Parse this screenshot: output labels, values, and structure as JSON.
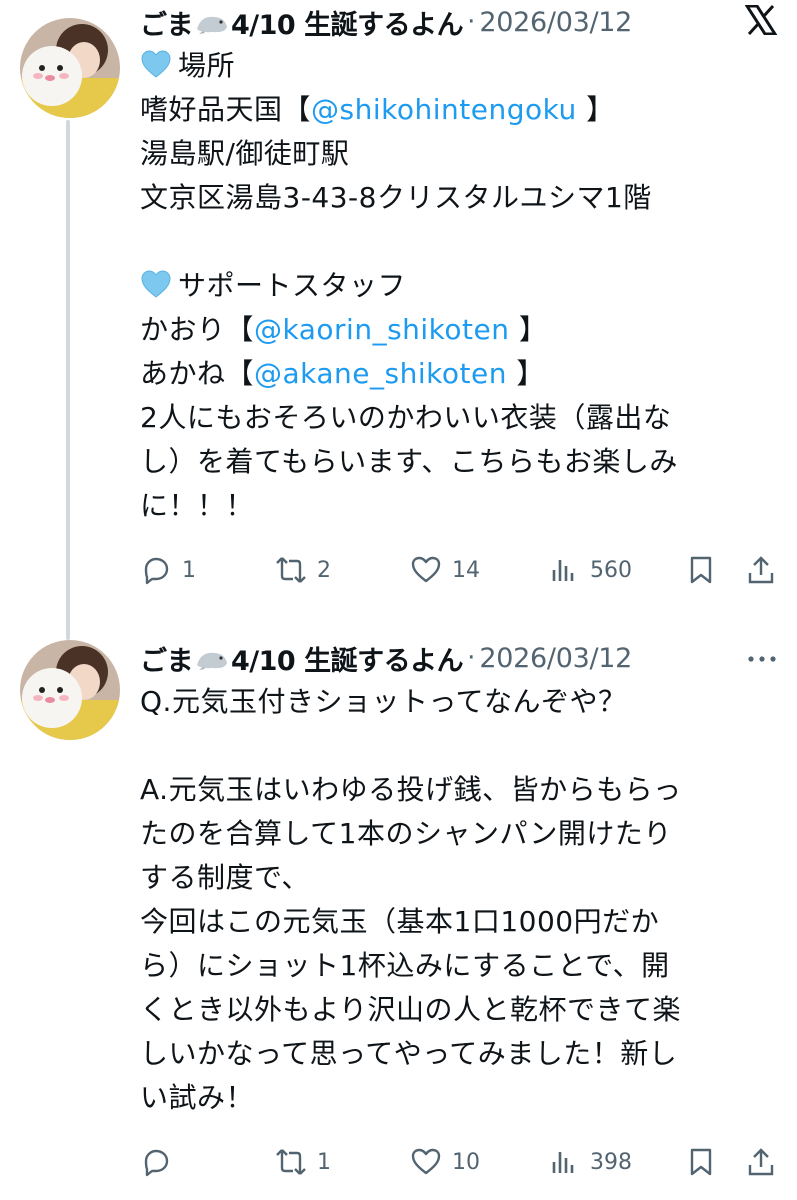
{
  "tweets": [
    {
      "author_name": "ごま",
      "author_suffix": "4/10 生誕するよん",
      "separator": "·",
      "date": "2026/03/12",
      "lines": [
        {
          "emoji": "light-blue-heart",
          "parts": [
            {
              "text": "場所"
            }
          ]
        },
        {
          "parts": [
            {
              "text": "嗜好品天国【"
            },
            {
              "text": "@shikohintengoku",
              "mention": true
            },
            {
              "text": " 】"
            }
          ]
        },
        {
          "parts": [
            {
              "text": "湯島駅/御徒町駅"
            }
          ]
        },
        {
          "parts": [
            {
              "text": "文京区湯島3-43-8クリスタルユシマ1階"
            }
          ]
        },
        {
          "parts": [
            {
              "text": ""
            }
          ]
        },
        {
          "emoji": "light-blue-heart",
          "parts": [
            {
              "text": "サポートスタッフ"
            }
          ]
        },
        {
          "parts": [
            {
              "text": "かおり【"
            },
            {
              "text": "@kaorin_shikoten",
              "mention": true
            },
            {
              "text": " 】"
            }
          ]
        },
        {
          "parts": [
            {
              "text": "あかね【"
            },
            {
              "text": "@akane_shikoten",
              "mention": true
            },
            {
              "text": " 】"
            }
          ]
        },
        {
          "parts": [
            {
              "text": "2人にもおそろいのかわいい衣装（露出な"
            }
          ]
        },
        {
          "parts": [
            {
              "text": "し）を着てもらいます、こちらもお楽しみ"
            }
          ]
        },
        {
          "parts": [
            {
              "text": "に！！！"
            }
          ]
        }
      ],
      "actions": {
        "replies": "1",
        "reposts": "2",
        "likes": "14",
        "views": "560"
      },
      "header_icon": "x-logo-icon"
    },
    {
      "author_name": "ごま",
      "author_suffix": "4/10 生誕するよん",
      "separator": "·",
      "date": "2026/03/12",
      "lines": [
        {
          "parts": [
            {
              "text": "Q.元気玉付きショットってなんぞや？"
            }
          ]
        },
        {
          "parts": [
            {
              "text": ""
            }
          ]
        },
        {
          "parts": [
            {
              "text": "A.元気玉はいわゆる投げ銭、皆からもらっ"
            }
          ]
        },
        {
          "parts": [
            {
              "text": "たのを合算して1本のシャンパン開けたり"
            }
          ]
        },
        {
          "parts": [
            {
              "text": "する制度で、"
            }
          ]
        },
        {
          "parts": [
            {
              "text": "今回はこの元気玉（基本1口1000円だか"
            }
          ]
        },
        {
          "parts": [
            {
              "text": "ら）にショット1杯込みにすることで、開"
            }
          ]
        },
        {
          "parts": [
            {
              "text": "くとき以外もより沢山の人と乾杯できて楽"
            }
          ]
        },
        {
          "parts": [
            {
              "text": "しいかなって思ってやってみました！新し"
            }
          ]
        },
        {
          "parts": [
            {
              "text": "い試み！"
            }
          ]
        }
      ],
      "actions": {
        "replies": "",
        "reposts": "1",
        "likes": "10",
        "views": "398"
      },
      "header_icon": "more-icon"
    }
  ],
  "colors": {
    "text": "#0f1419",
    "muted": "#536471",
    "mention": "#1d9bf0",
    "thread": "#cfd9de"
  }
}
